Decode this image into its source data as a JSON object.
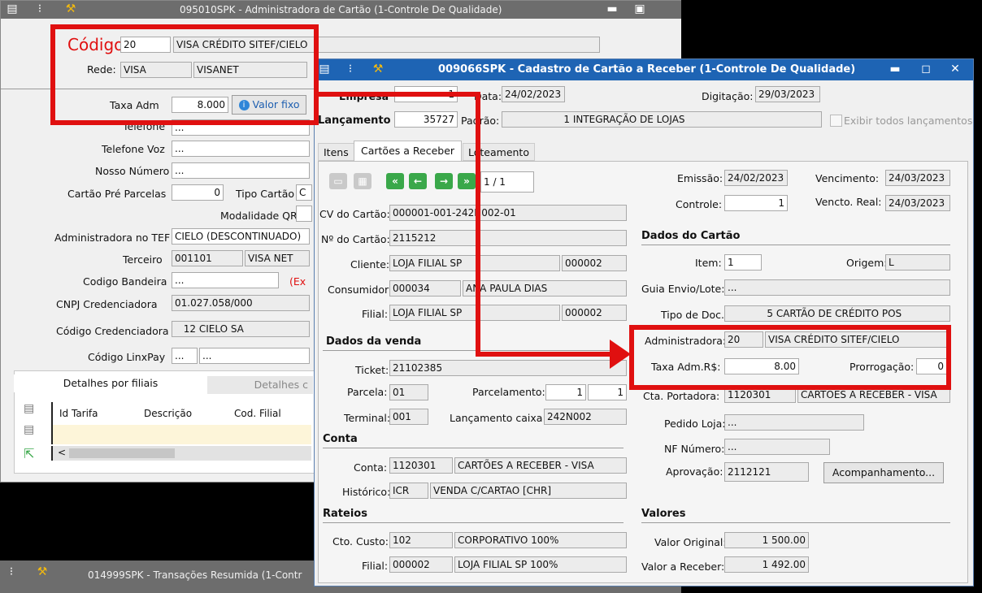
{
  "back_window": {
    "title": "095010SPK - Administradora de Cartão (1-Controle De Qualidade)",
    "codigo_label": "Código",
    "codigo_value": "20",
    "codigo_desc": "VISA CRÉDITO SITEF/CIELO",
    "rede_label": "Rede:",
    "rede_value": "VISA",
    "rede_desc": "VISANET",
    "taxa_label": "Taxa Adm",
    "taxa_value": "8.000",
    "valor_fixo_label": "Valor fixo",
    "telefone_label": "Telefone",
    "telefone_value": "...",
    "telefone_voz_label": "Telefone Voz",
    "telefone_voz_value": "...",
    "nosso_numero_label": "Nosso Número",
    "nosso_numero_value": "...",
    "cartao_pre_label": "Cartão Pré Parcelas",
    "cartao_pre_value": "0",
    "tipo_cartao_label": "Tipo Cartão",
    "tipo_cartao_value": "C",
    "modalidade_label": "Modalidade QR",
    "adm_tef_label": "Administradora no TEF",
    "adm_tef_value": "CIELO (DESCONTINUADO)",
    "terceiro_label": "Terceiro",
    "terceiro_code": "001101",
    "terceiro_name": "VISA NET",
    "codigo_bandeira_label": "Codigo Bandeira",
    "codigo_bandeira_value": "...",
    "codigo_bandeira_extra": "(Ex",
    "cnpj_label": "CNPJ Credenciadora",
    "cnpj_value": "01.027.058/000",
    "cod_cred_label": "Código Credenciadora",
    "cod_cred_value": "12",
    "cod_cred_name": "CIELO SA",
    "linxpay_label": "Código LinxPay",
    "linxpay_value1": "...",
    "linxpay_value2": "...",
    "tab_filiais": "Detalhes por filiais",
    "tab_detalhes": "Detalhes c",
    "col_id_tarifa": "Id Tarifa",
    "col_descricao": "Descrição",
    "col_cod_filial": "Cod. Filial"
  },
  "bottom_window": {
    "title": "014999SPK - Transações Resumida (1-Contr"
  },
  "front_window": {
    "title": "009066SPK - Cadastro de Cartão a Receber (1-Controle De Qualidade)",
    "empresa_label": "Empresa",
    "empresa_value": "1",
    "data_label": "Data:",
    "data_value": "24/02/2023",
    "digitacao_label": "Digitação:",
    "digitacao_value": "29/03/2023",
    "lancamento_label": "Lançamento",
    "lancamento_value": "35727",
    "padrao_label": "Padrão:",
    "padrao_value": "1",
    "padrao_desc": "INTEGRAÇÃO DE LOJAS",
    "exibir_label": "Exibir todos lançamentos",
    "tabs": [
      "Itens",
      "Cartões a Receber",
      "Loteamento"
    ],
    "pager": "1 / 1",
    "cv_label": "CV do Cartão:",
    "cv_value": "000001-001-242N002-01",
    "num_cartao_label": "Nº do Cartão:",
    "num_cartao_value": "2115212",
    "cliente_label": "Cliente:",
    "cliente_value": "LOJA FILIAL SP",
    "cliente_code": "000002",
    "consumidor_label": "Consumidor:",
    "consumidor_code": "000034",
    "consumidor_name": "ANA PAULA DIAS",
    "filial_label": "Filial:",
    "filial_value": "LOJA FILIAL SP",
    "filial_code": "000002",
    "emissao_label": "Emissão:",
    "emissao_value": "24/02/2023",
    "vencimento_label": "Vencimento:",
    "vencimento_value": "24/03/2023",
    "controle_label": "Controle:",
    "controle_value": "1",
    "vencto_real_label": "Vencto. Real:",
    "vencto_real_value": "24/03/2023",
    "dados_cartao": "Dados do Cartão",
    "item_label": "Item:",
    "item_value": "1",
    "origem_label": "Origem:",
    "origem_value": "L",
    "guia_label": "Guia Envio/Lote:",
    "guia_value": "...",
    "tipo_doc_label": "Tipo de Doc.:",
    "tipo_doc_code": "5",
    "tipo_doc_desc": "CARTÃO DE CRÉDITO POS",
    "administradora_label": "Administradora:",
    "administradora_code": "20",
    "administradora_desc": "VISA CRÉDITO SITEF/CIELO",
    "taxa_adm_label": "Taxa Adm.R$:",
    "taxa_adm_value": "8.00",
    "prorrogacao_label": "Prorrogação:",
    "prorrogacao_value": "0",
    "cta_portadora_label": "Cta. Portadora:",
    "cta_portadora_code": "1120301",
    "cta_portadora_desc": "CARTÕES A RECEBER - VISA",
    "pedido_label": "Pedido Loja:",
    "pedido_value": "...",
    "nf_label": "NF Número:",
    "nf_value": "...",
    "aprovacao_label": "Aprovação:",
    "aprovacao_value": "2112121",
    "acompanhamento_label": "Acompanhamento...",
    "dados_venda": "Dados da venda",
    "ticket_label": "Ticket:",
    "ticket_value": "21102385",
    "parcela_label": "Parcela:",
    "parcela_value": "01",
    "parcelamento_label": "Parcelamento:",
    "parcelamento_value1": "1",
    "parcelamento_value2": "1",
    "terminal_label": "Terminal:",
    "terminal_value": "001",
    "lanc_caixa_label": "Lançamento caixa:",
    "lanc_caixa_value": "242N002",
    "conta_section": "Conta",
    "conta_label": "Conta:",
    "conta_code": "1120301",
    "conta_desc": "CARTÕES A RECEBER - VISA",
    "historico_label": "Histórico:",
    "historico_code": "ICR",
    "historico_desc": "VENDA C/CARTAO [CHR]",
    "rateios": "Rateios",
    "cto_custo_label": "Cto. Custo:",
    "cto_custo_code": "102",
    "cto_custo_desc": "CORPORATIVO 100%",
    "rateio_filial_label": "Filial:",
    "rateio_filial_code": "000002",
    "rateio_filial_desc": "LOJA FILIAL SP 100%",
    "valores": "Valores",
    "valor_original_label": "Valor Original:",
    "valor_original_value": "1 500.00",
    "valor_receber_label": "Valor a Receber:",
    "valor_receber_value": "1 492.00"
  },
  "colors": {
    "title_gray": "#6d6d6d",
    "title_blue": "#1e64b4",
    "highlight_red": "#e01010",
    "nav_green": "#3aa84a"
  }
}
